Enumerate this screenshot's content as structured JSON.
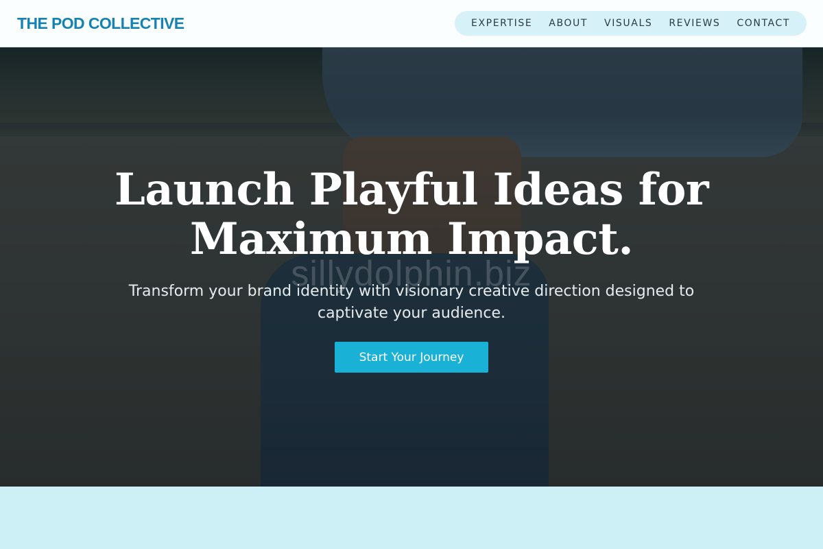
{
  "header": {
    "brand": "THE POD COLLECTIVE",
    "nav": [
      "EXPERTISE",
      "ABOUT",
      "VISUALS",
      "REVIEWS",
      "CONTACT"
    ]
  },
  "hero": {
    "headline_line1": "Launch Playful Ideas for",
    "headline_line2": "Maximum Impact.",
    "subheadline": "Transform your brand identity with visionary creative direction designed to captivate your audience.",
    "cta_label": "Start Your Journey",
    "watermark": "sillydolphin.biz"
  },
  "colors": {
    "brand": "#1682b3",
    "nav_pill_bg": "#d6f1f8",
    "cta_bg": "#1ab1d6",
    "below_section_bg": "#cdf0f7"
  }
}
